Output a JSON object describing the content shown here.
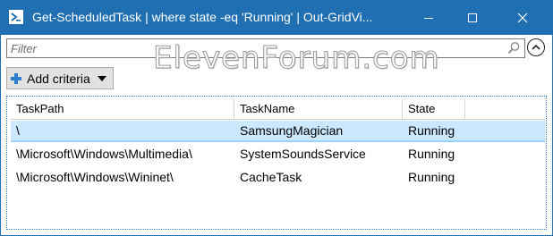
{
  "window": {
    "title": "Get-ScheduledTask | where state -eq 'Running' | Out-GridVi...",
    "colors": {
      "titlebar": "#1f6fb2",
      "selection": "#cce8ff"
    }
  },
  "filter": {
    "placeholder": "Filter",
    "value": ""
  },
  "watermark": "ElevenForum.com",
  "toolbar": {
    "add_criteria_label": "Add criteria"
  },
  "table": {
    "columns": [
      "TaskPath",
      "TaskName",
      "State",
      ""
    ],
    "rows": [
      {
        "path": "\\",
        "name": "SamsungMagician",
        "state": "Running",
        "selected": true
      },
      {
        "path": "\\Microsoft\\Windows\\Multimedia\\",
        "name": "SystemSoundsService",
        "state": "Running",
        "selected": false
      },
      {
        "path": "\\Microsoft\\Windows\\Wininet\\",
        "name": "CacheTask",
        "state": "Running",
        "selected": false
      }
    ]
  },
  "icons": [
    "powershell-icon",
    "minimize-icon",
    "maximize-icon",
    "close-icon",
    "search-icon",
    "collapse-chevron-icon",
    "plus-icon",
    "dropdown-arrow-icon"
  ]
}
